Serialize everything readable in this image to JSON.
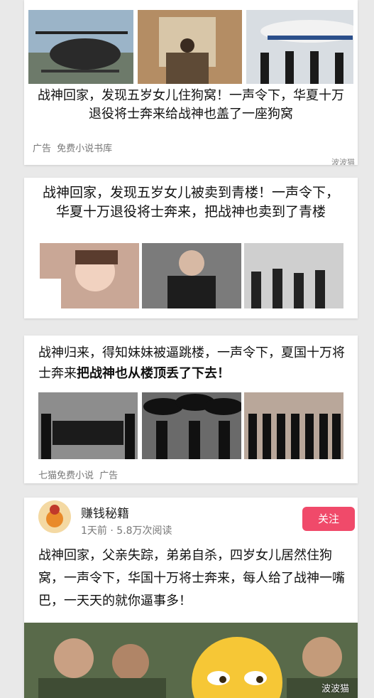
{
  "feed": [
    {
      "title": "战神回家，发现五岁女儿住狗窝！一声令下，华夏十万退役将士奔来给战神也盖了一座狗窝",
      "tag_ad": "广告",
      "source": "免费小说书库",
      "watermark": "波波猫"
    },
    {
      "title": "战神回家，发现五岁女儿被卖到青楼！一声令下，华夏十万退役将士奔来，把战神也卖到了青楼"
    },
    {
      "title_normal": "战神归来，得知妹妹被逼跳楼，一声令下，夏国十万将士奔来",
      "title_bold": "把战神也从楼顶丢了下去！",
      "source": "七猫免费小说",
      "tag_ad": "广告"
    },
    {
      "author": "赚钱秘籍",
      "time": "1天前",
      "reads": "5.8万次阅读",
      "follow_label": "关注",
      "body": "战神回家，父亲失踪，弟弟自杀，四岁女儿居然住狗窝，一声令下，华国十万将士奔来，每人给了战神一嘴巴，一天天的就你逼事多！"
    }
  ],
  "bottom_watermark": "波波猫",
  "colors": {
    "accent": "#f04a6a",
    "page_bg": "#e9e9e9"
  }
}
